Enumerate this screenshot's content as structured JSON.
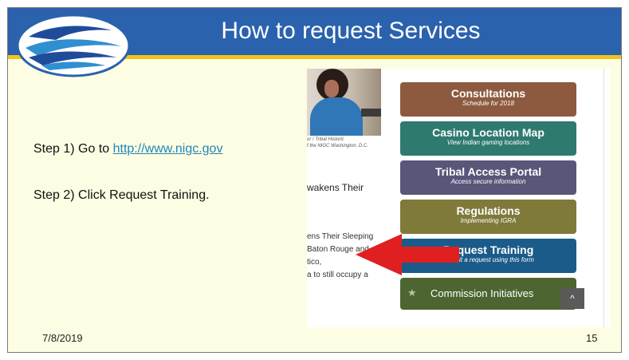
{
  "slide": {
    "title": "How to request Services",
    "steps": {
      "step1_prefix": "Step 1) Go to ",
      "step1_link": "http://www.nigc.gov",
      "step2": "Step 2) Click Request Training."
    },
    "footer": {
      "date": "7/8/2019",
      "page_number": "15"
    }
  },
  "screenshot": {
    "caption_line1": "or / Tribal Historic",
    "caption_line2": "f the NIGC Washington, D.C.",
    "headline": "wakens Their",
    "body_lines": [
      "ens Their Sleeping",
      "Baton Rouge and",
      "tico,",
      "a to still occupy a"
    ],
    "services": [
      {
        "title": "Consultations",
        "subtitle": "Schedule for 2018",
        "color": "#8d5a3f"
      },
      {
        "title": "Casino Location Map",
        "subtitle": "View Indian gaming locations",
        "color": "#2f7a6f"
      },
      {
        "title": "Tribal Access Portal",
        "subtitle": "Access secure information",
        "color": "#58577a"
      },
      {
        "title": "Regulations",
        "subtitle": "Implementing IGRA",
        "color": "#7f7a3a"
      },
      {
        "title": "Request Training",
        "subtitle": "Submit a request using this form",
        "color": "#1a5b8a"
      },
      {
        "title": "Commission Initiatives",
        "subtitle": "",
        "color": "#4d6531"
      }
    ],
    "up_icon": "chevron-up-icon",
    "star_icon": "star-icon"
  },
  "colors": {
    "header": "#2b62ad",
    "header_rule": "#f2c21a",
    "slide_background": "#fdfde3",
    "link": "#1f86b9",
    "arrow": "#e02020"
  }
}
